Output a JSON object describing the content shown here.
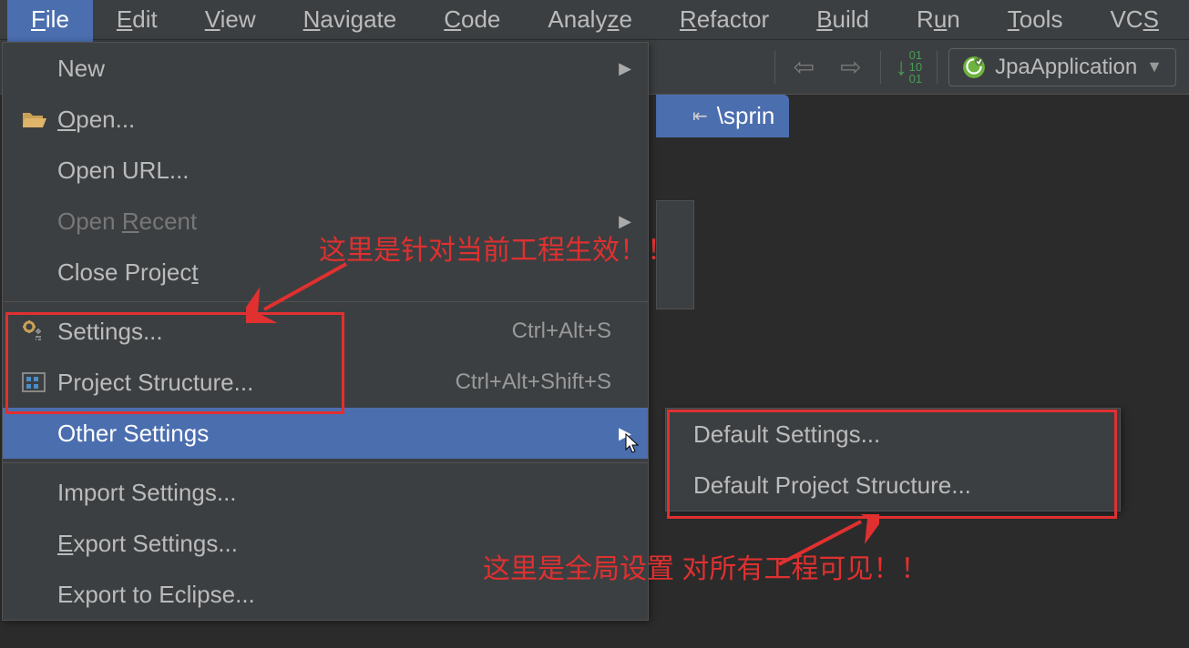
{
  "menubar": {
    "items": [
      {
        "letter": "F",
        "rest": "ile",
        "active": true
      },
      {
        "letter": "E",
        "rest": "dit"
      },
      {
        "letter": "V",
        "rest": "iew"
      },
      {
        "letter": "N",
        "rest": "avigate"
      },
      {
        "letter": "C",
        "rest": "ode"
      },
      {
        "letter": "",
        "rest": "Analyze",
        "plain": true,
        "underline_idx": 5
      },
      {
        "letter": "R",
        "rest": "efactor"
      },
      {
        "letter": "B",
        "rest": "uild"
      },
      {
        "letter": "",
        "rest": "Run",
        "plain": true,
        "underline_idx": 1
      },
      {
        "letter": "T",
        "rest": "ools"
      },
      {
        "letter": "",
        "rest": "VCS",
        "plain": true,
        "underline_idx": 2
      }
    ]
  },
  "toolbar": {
    "run_config": "JpaApplication"
  },
  "breadcrumb": {
    "label": "\\sprin"
  },
  "file_menu": {
    "new": "New",
    "open": {
      "pre": "",
      "u": "O",
      "post": "pen..."
    },
    "open_url": "Open URL...",
    "open_recent": {
      "pre": "Open ",
      "u": "R",
      "post": "ecent"
    },
    "close_project": {
      "pre": "Close Projec",
      "u": "t",
      "post": ""
    },
    "settings": {
      "label": "Settings...",
      "shortcut": "Ctrl+Alt+S"
    },
    "project_structure": {
      "label": "Project Structure...",
      "shortcut": "Ctrl+Alt+Shift+S"
    },
    "other_settings": "Other Settings",
    "import_settings": "Import Settings...",
    "export_settings": {
      "pre": "",
      "u": "E",
      "post": "xport Settings..."
    },
    "export_eclipse": "Export to Eclipse..."
  },
  "submenu": {
    "default_settings": {
      "pre": "Def",
      "u": "a",
      "post": "ult Settings..."
    },
    "default_structure": "Default Project Structure..."
  },
  "annotations": {
    "top": "这里是针对当前工程生效！！",
    "bottom": "这里是全局设置 对所有工程可见！！"
  }
}
